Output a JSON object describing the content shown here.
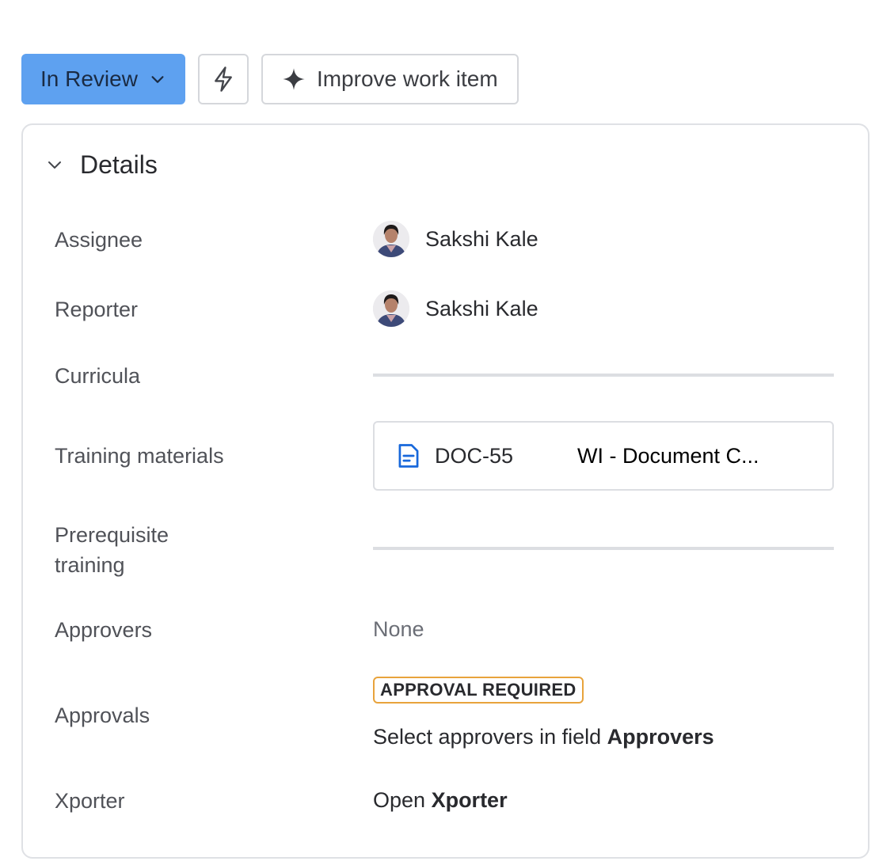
{
  "toolbar": {
    "status_label": "In Review",
    "improve_label": "Improve work item"
  },
  "details": {
    "heading": "Details",
    "assignee": {
      "label": "Assignee",
      "name": "Sakshi Kale"
    },
    "reporter": {
      "label": "Reporter",
      "name": "Sakshi Kale"
    },
    "curricula": {
      "label": "Curricula"
    },
    "training_materials": {
      "label": "Training materials",
      "doc_key": "DOC-55",
      "doc_title": "WI - Document C..."
    },
    "prerequisite": {
      "label_line1": "Prerequisite",
      "label_line2": "training"
    },
    "approvers": {
      "label": "Approvers",
      "value": "None"
    },
    "approvals": {
      "label": "Approvals",
      "lozenge": "APPROVAL REQUIRED",
      "hint_prefix": "Select approvers in field ",
      "hint_field": "Approvers"
    },
    "xporter": {
      "label": "Xporter",
      "prefix": "Open ",
      "link": "Xporter"
    }
  },
  "colors": {
    "status_bg": "#5ea1f0",
    "lozenge_border": "#e8a33c",
    "doc_icon": "#1868db"
  }
}
